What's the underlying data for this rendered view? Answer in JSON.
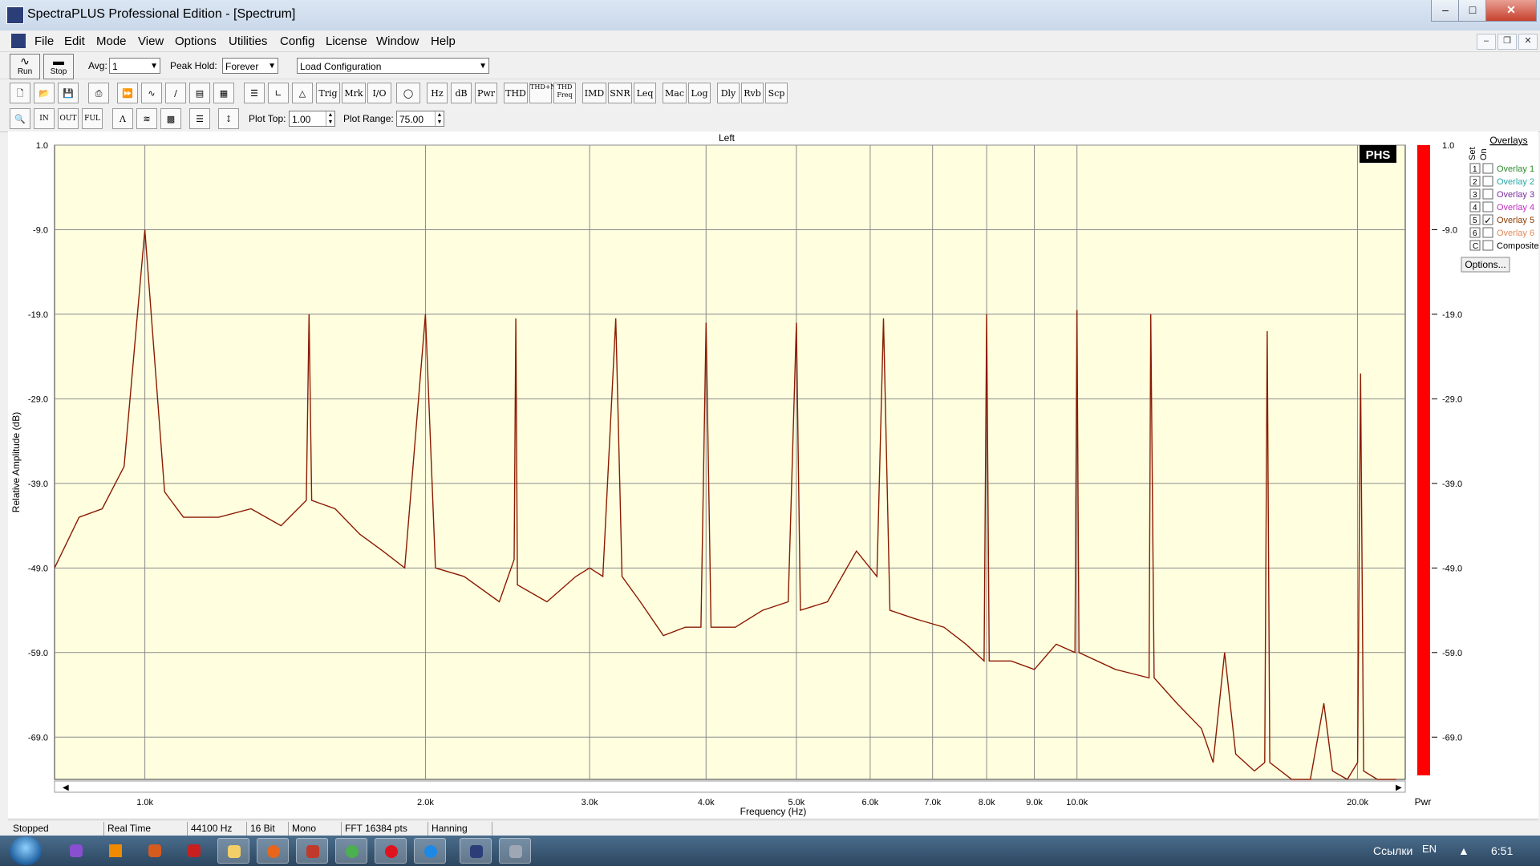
{
  "window": {
    "title": "SpectraPLUS Professional Edition - [Spectrum]"
  },
  "menu": [
    "File",
    "Edit",
    "Mode",
    "View",
    "Options",
    "Utilities",
    "Config",
    "License",
    "Window",
    "Help"
  ],
  "toolbar1": {
    "run_label": "Run",
    "stop_label": "Stop",
    "avg_label": "Avg:",
    "avg_value": "1",
    "peak_label": "Peak Hold:",
    "peak_value": "Forever",
    "config_value": "Load Configuration"
  },
  "toolbar2": {
    "buttons": [
      "Trig",
      "Mrk",
      "I/O",
      "Hz",
      "dB",
      "Pwr",
      "THD",
      "THD+N",
      "THD Freq",
      "IMD",
      "SNR",
      "Leq",
      "Mac",
      "Log",
      "Dly",
      "Rvb",
      "Scp"
    ]
  },
  "toolbar3": {
    "plot_top_label": "Plot Top:",
    "plot_top_value": "1.00",
    "plot_range_label": "Plot Range:",
    "plot_range_value": "75.00"
  },
  "chart_data": {
    "type": "line",
    "title": "Left",
    "xlabel": "Frequency (Hz)",
    "ylabel": "Relative Amplitude (dB)",
    "x_scale": "log",
    "xlim": [
      800,
      22500
    ],
    "ylim": [
      -74.0,
      1.0
    ],
    "yticks": [
      1.0,
      -9.0,
      -19.0,
      -29.0,
      -39.0,
      -49.0,
      -59.0,
      -69.0
    ],
    "ytick_labels": [
      "1.0",
      "-9.0",
      "-19.0",
      "-29.0",
      "-39.0",
      "-49.0",
      "-59.0",
      "-69.0"
    ],
    "xticks": [
      1000,
      2000,
      3000,
      4000,
      5000,
      6000,
      7000,
      8000,
      9000,
      10000,
      20000
    ],
    "xtick_labels": [
      "1.0k",
      "2.0k",
      "3.0k",
      "4.0k",
      "5.0k",
      "6.0k",
      "7.0k",
      "8.0k",
      "9.0k",
      "10.0k",
      "20.0k"
    ],
    "grid": true,
    "background": "#ffffe0",
    "series": [
      {
        "color": "#8b1a00",
        "points": [
          [
            800,
            -49
          ],
          [
            850,
            -43
          ],
          [
            900,
            -42
          ],
          [
            950,
            -37
          ],
          [
            1000,
            -9
          ],
          [
            1050,
            -40
          ],
          [
            1100,
            -43
          ],
          [
            1200,
            -43
          ],
          [
            1300,
            -42
          ],
          [
            1400,
            -44
          ],
          [
            1490,
            -41
          ],
          [
            1500,
            -19
          ],
          [
            1510,
            -41
          ],
          [
            1600,
            -42
          ],
          [
            1700,
            -45
          ],
          [
            1800,
            -47
          ],
          [
            1900,
            -49
          ],
          [
            2000,
            -19
          ],
          [
            2050,
            -49
          ],
          [
            2200,
            -50
          ],
          [
            2400,
            -53
          ],
          [
            2490,
            -48
          ],
          [
            2500,
            -19.5
          ],
          [
            2510,
            -51
          ],
          [
            2700,
            -53
          ],
          [
            2900,
            -50
          ],
          [
            3000,
            -49
          ],
          [
            3100,
            -50
          ],
          [
            3200,
            -19.5
          ],
          [
            3250,
            -50
          ],
          [
            3400,
            -53
          ],
          [
            3600,
            -57
          ],
          [
            3800,
            -56
          ],
          [
            3950,
            -56
          ],
          [
            4000,
            -20
          ],
          [
            4050,
            -56
          ],
          [
            4300,
            -56
          ],
          [
            4600,
            -54
          ],
          [
            4900,
            -53
          ],
          [
            5000,
            -20
          ],
          [
            5050,
            -54
          ],
          [
            5400,
            -53
          ],
          [
            5800,
            -47
          ],
          [
            6100,
            -50
          ],
          [
            6200,
            -19.5
          ],
          [
            6300,
            -54
          ],
          [
            6700,
            -55
          ],
          [
            7200,
            -56
          ],
          [
            7600,
            -58
          ],
          [
            7950,
            -60
          ],
          [
            8000,
            -19
          ],
          [
            8050,
            -60
          ],
          [
            8500,
            -60
          ],
          [
            9000,
            -61
          ],
          [
            9500,
            -58
          ],
          [
            9950,
            -59
          ],
          [
            10000,
            -18.5
          ],
          [
            10050,
            -59
          ],
          [
            11000,
            -61
          ],
          [
            11950,
            -62
          ],
          [
            12000,
            -19
          ],
          [
            12100,
            -62
          ],
          [
            12800,
            -65
          ],
          [
            13600,
            -68
          ],
          [
            14000,
            -72
          ],
          [
            14400,
            -59
          ],
          [
            14800,
            -71
          ],
          [
            15500,
            -73
          ],
          [
            15900,
            -72
          ],
          [
            16000,
            -21
          ],
          [
            16100,
            -72
          ],
          [
            17000,
            -74
          ],
          [
            17800,
            -74
          ],
          [
            18400,
            -65
          ],
          [
            18800,
            -73
          ],
          [
            19500,
            -74
          ],
          [
            20000,
            -72
          ],
          [
            20150,
            -26
          ],
          [
            20300,
            -73
          ],
          [
            21000,
            -74
          ],
          [
            22000,
            -74
          ]
        ]
      }
    ]
  },
  "overlays": {
    "header": "Overlays",
    "col_set": "Set",
    "col_on": "On",
    "items": [
      {
        "num": "1",
        "name": "Overlay 1",
        "checked": false,
        "color": "#2e8b2e"
      },
      {
        "num": "2",
        "name": "Overlay 2",
        "checked": false,
        "color": "#2aa6a6"
      },
      {
        "num": "3",
        "name": "Overlay 3",
        "checked": false,
        "color": "#7b2a9e"
      },
      {
        "num": "4",
        "name": "Overlay 4",
        "checked": false,
        "color": "#c22ec2"
      },
      {
        "num": "5",
        "name": "Overlay 5",
        "checked": true,
        "color": "#8b3a00"
      },
      {
        "num": "6",
        "name": "Overlay 6",
        "checked": false,
        "color": "#e08a5a"
      },
      {
        "num": "C",
        "name": "Composite",
        "checked": false,
        "color": "#000000"
      }
    ],
    "options_label": "Options..."
  },
  "meter": {
    "top_label": "1.0",
    "labels": [
      "-9.0",
      "-19.0",
      "-29.0",
      "-39.0",
      "-49.0",
      "-59.0",
      "-69.0"
    ],
    "bottom_label": "Pwr",
    "color": "#ff0000"
  },
  "watermark": "PHS",
  "status": [
    "Stopped",
    "Real Time",
    "44100 Hz",
    "16 Bit",
    "Mono",
    "FFT 16384 pts",
    "Hanning"
  ],
  "taskbar": {
    "lang": "EN",
    "links": "Ссылки",
    "time": "6:51"
  }
}
